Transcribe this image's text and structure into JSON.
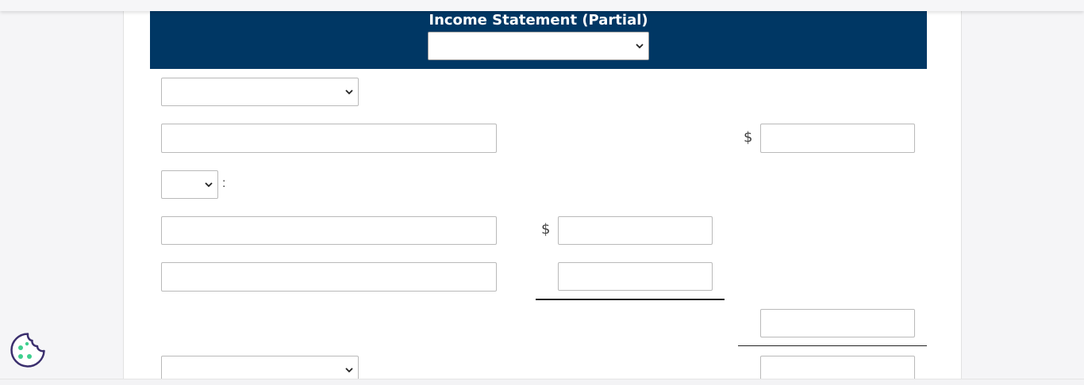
{
  "statement": {
    "title": "Income Statement (Partial)",
    "period_select": {
      "selected": ""
    }
  },
  "rows": {
    "row1_select": {
      "selected": ""
    },
    "row2_input": {
      "value": ""
    },
    "row2_currency": "$",
    "row2_amount": {
      "value": ""
    },
    "row3_select": {
      "selected": ""
    },
    "row3_colon": ":",
    "row4_input": {
      "value": ""
    },
    "row4_currency": "$",
    "row4_amount": {
      "value": ""
    },
    "row5_input": {
      "value": ""
    },
    "row5_amount": {
      "value": ""
    },
    "row6_amount": {
      "value": ""
    },
    "row7_select": {
      "selected": ""
    },
    "row7_amount": {
      "value": ""
    }
  },
  "icons": {
    "cookie": "cookie-icon",
    "dropdown": "chevron-down-icon"
  },
  "colors": {
    "header_band": "#003764",
    "header_text": "#ffffff",
    "cookie_stroke": "#3b2f6e",
    "cookie_dots": "#3fcf8e"
  }
}
